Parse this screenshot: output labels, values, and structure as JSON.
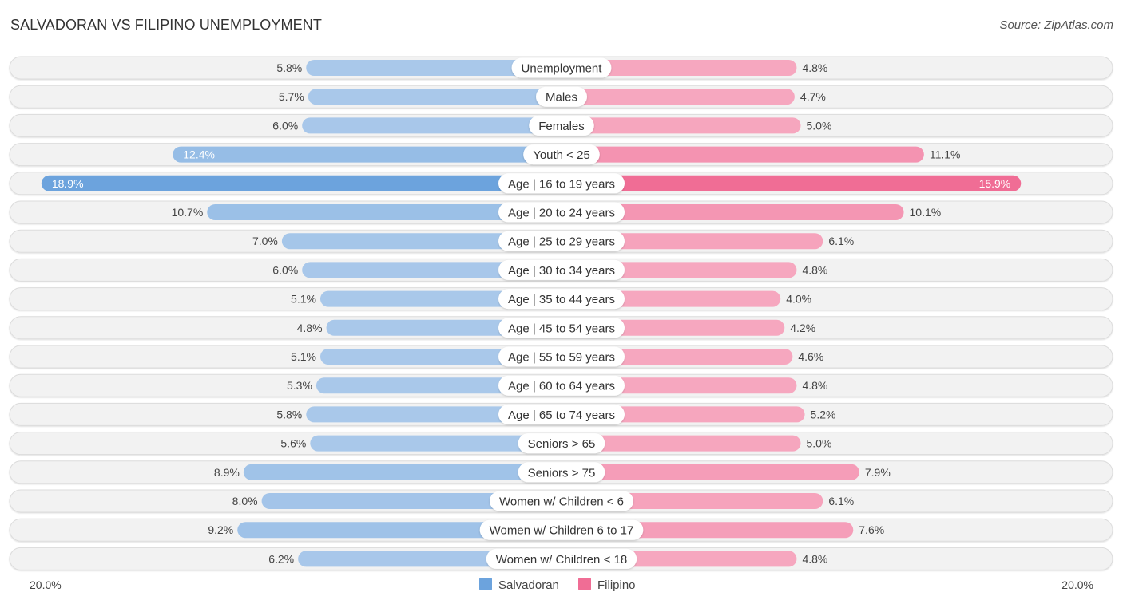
{
  "header": {
    "title": "SALVADORAN VS FILIPINO UNEMPLOYMENT",
    "source": "Source: ZipAtlas.com"
  },
  "chart_data": {
    "type": "bar",
    "orientation": "horizontal-diverging",
    "title": "SALVADORAN VS FILIPINO UNEMPLOYMENT",
    "xlabel": "",
    "ylabel": "",
    "xlim": [
      0,
      20.0
    ],
    "axis_labels": {
      "left": "20.0%",
      "right": "20.0%"
    },
    "legend": {
      "placement": "bottom-center",
      "entries": [
        "Salvadoran",
        "Filipino"
      ]
    },
    "colors": {
      "Salvadoran": "#6ca3dd",
      "Filipino": "#f06d95",
      "Salvadoran_light": "#a9c8ea",
      "Filipino_light": "#f6a7bf"
    },
    "categories": [
      "Unemployment",
      "Males",
      "Females",
      "Youth < 25",
      "Age | 16 to 19 years",
      "Age | 20 to 24 years",
      "Age | 25 to 29 years",
      "Age | 30 to 34 years",
      "Age | 35 to 44 years",
      "Age | 45 to 54 years",
      "Age | 55 to 59 years",
      "Age | 60 to 64 years",
      "Age | 65 to 74 years",
      "Seniors > 65",
      "Seniors > 75",
      "Women w/ Children < 6",
      "Women w/ Children 6 to 17",
      "Women w/ Children < 18"
    ],
    "series": [
      {
        "name": "Salvadoran",
        "values": [
          5.8,
          5.7,
          6.0,
          12.4,
          18.9,
          10.7,
          7.0,
          6.0,
          5.1,
          4.8,
          5.1,
          5.3,
          5.8,
          5.6,
          8.9,
          8.0,
          9.2,
          6.2
        ]
      },
      {
        "name": "Filipino",
        "values": [
          4.8,
          4.7,
          5.0,
          11.1,
          15.9,
          10.1,
          6.1,
          4.8,
          4.0,
          4.2,
          4.6,
          4.8,
          5.2,
          5.0,
          7.9,
          6.1,
          7.6,
          4.8
        ]
      }
    ],
    "unit": "%"
  }
}
